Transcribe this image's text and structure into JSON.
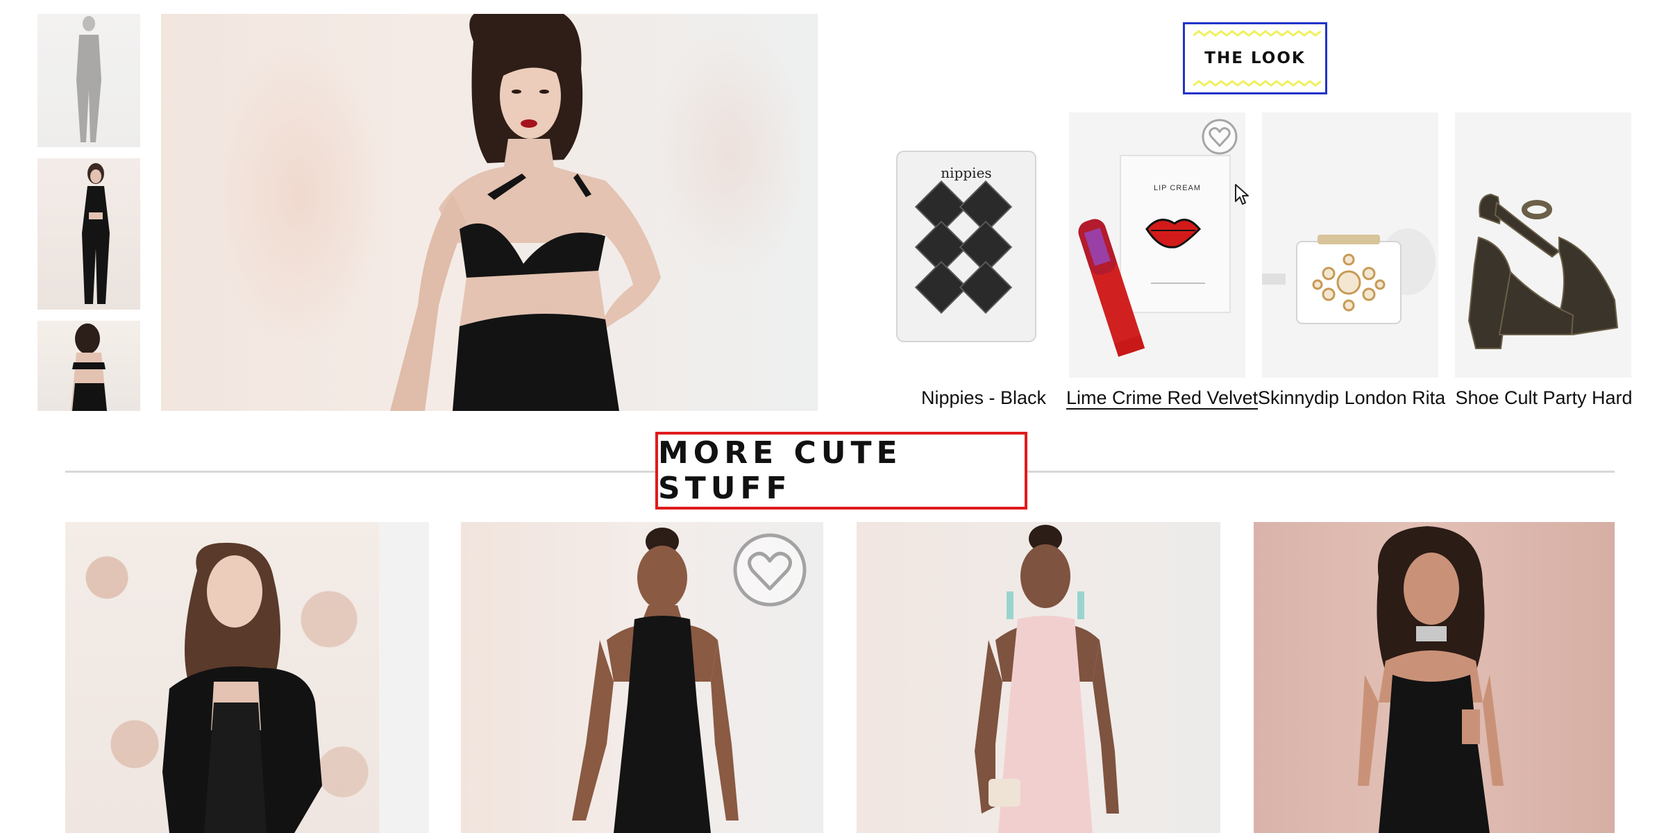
{
  "gallery": {
    "thumbnails": [
      "thumbnail-front",
      "thumbnail-full",
      "thumbnail-back"
    ]
  },
  "the_look": {
    "tag_label": "THE LOOK",
    "products": [
      {
        "name": "Nippies - Black",
        "package_brand": "nippies"
      },
      {
        "name": "Lime Crime Red Velvet",
        "package_text": "LIP CREAM"
      },
      {
        "name": "Skinnydip London Rita"
      },
      {
        "name": "Shoe Cult Party Hard"
      }
    ]
  },
  "more_cute_stuff": {
    "title": "MORE CUTE STUFF"
  },
  "colors": {
    "look_tag_border": "#2234c8",
    "section_title_border": "#e01b1b",
    "zigzag": "#f0f060"
  },
  "icons": [
    "heart-icon",
    "heart-icon",
    "cursor-arrow-icon"
  ]
}
